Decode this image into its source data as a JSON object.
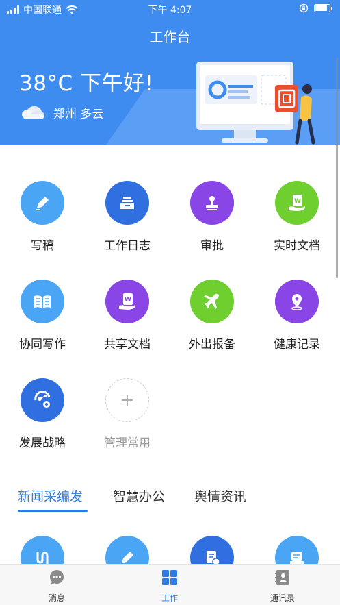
{
  "status_bar": {
    "carrier": "中国联通",
    "time": "下午 4:07",
    "battery_level": 0.85
  },
  "header": {
    "title": "工作台",
    "greeting": "38°C 下午好!",
    "location": "郑州 多云",
    "weather_icon": "cloudy-icon"
  },
  "grid": {
    "items": [
      {
        "label": "写稿",
        "icon": "pencil-icon",
        "color": "#4aa6f4"
      },
      {
        "label": "工作日志",
        "icon": "inbox-tray-icon",
        "color": "#2f6fe0"
      },
      {
        "label": "审批",
        "icon": "stamp-icon",
        "color": "#8a45e6"
      },
      {
        "label": "实时文档",
        "icon": "document-hand-icon",
        "color": "#6fcf2f"
      },
      {
        "label": "协同写作",
        "icon": "open-book-icon",
        "color": "#4aa6f4"
      },
      {
        "label": "共享文档",
        "icon": "document-hand-icon",
        "color": "#8a45e6"
      },
      {
        "label": "外出报备",
        "icon": "airplane-icon",
        "color": "#6fcf2f"
      },
      {
        "label": "健康记录",
        "icon": "location-pin-icon",
        "color": "#8a45e6"
      },
      {
        "label": "发展战略",
        "icon": "strategy-gear-icon",
        "color": "#2f6fe0"
      }
    ],
    "add_label": "管理常用"
  },
  "tabs": {
    "items": [
      "新闻采编发",
      "智慧办公",
      "舆情资讯"
    ],
    "active": "新闻采编发"
  },
  "second_row_icons": [
    {
      "icon": "route-icon",
      "color": "#4aa6f4"
    },
    {
      "icon": "pencil-icon",
      "color": "#4aa6f4"
    },
    {
      "icon": "doc-clock-icon",
      "color": "#2f6fe0"
    },
    {
      "icon": "message-box-icon",
      "color": "#4aa6f4"
    }
  ],
  "bottom_nav": {
    "items": [
      {
        "label": "消息",
        "icon": "chat-bubble-icon"
      },
      {
        "label": "工作",
        "icon": "grid-icon"
      },
      {
        "label": "通讯录",
        "icon": "contacts-book-icon"
      }
    ],
    "active": "工作"
  },
  "colors": {
    "header_blue": "#3f8cf0",
    "accent": "#2e7be6"
  }
}
